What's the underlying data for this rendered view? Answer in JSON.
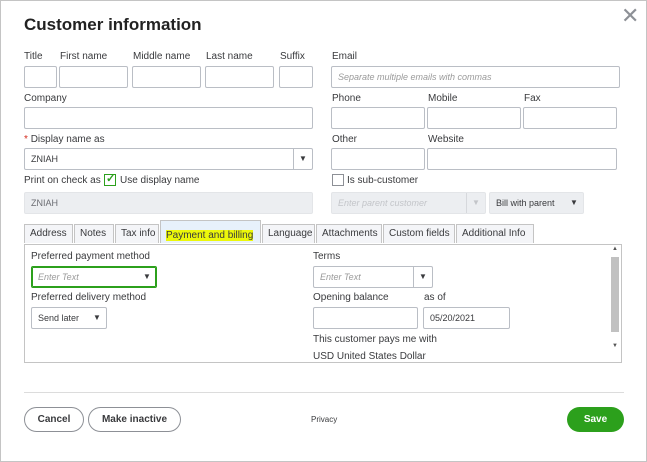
{
  "dialog": {
    "title": "Customer information",
    "close_glyph": "✕"
  },
  "name": {
    "title_label": "Title",
    "first_label": "First name",
    "middle_label": "Middle name",
    "last_label": "Last name",
    "suffix_label": "Suffix"
  },
  "email": {
    "label": "Email",
    "placeholder": "Separate multiple emails with commas"
  },
  "company": {
    "label": "Company"
  },
  "phone": {
    "label": "Phone"
  },
  "mobile": {
    "label": "Mobile"
  },
  "fax": {
    "label": "Fax"
  },
  "display_name": {
    "required_mark": "*",
    "label": "Display name as",
    "value": "ZNIAH"
  },
  "other": {
    "label": "Other"
  },
  "website": {
    "label": "Website"
  },
  "print_on_check": {
    "label": "Print on check as",
    "use_display_label": "Use display name",
    "checked": true,
    "value": "ZNIAH"
  },
  "sub_customer": {
    "label": "Is sub-customer",
    "parent_placeholder": "Enter parent customer",
    "bill_with_parent": "Bill with parent"
  },
  "tabs": [
    {
      "label": "Address"
    },
    {
      "label": "Notes"
    },
    {
      "label": "Tax info"
    },
    {
      "label": "Payment and billing"
    },
    {
      "label": "Language"
    },
    {
      "label": "Attachments"
    },
    {
      "label": "Custom fields"
    },
    {
      "label": "Additional Info"
    }
  ],
  "active_tab": "Payment and billing",
  "payment": {
    "preferred_method_label": "Preferred payment method",
    "preferred_method_placeholder": "Enter Text",
    "delivery_label": "Preferred delivery method",
    "delivery_value": "Send later",
    "terms_label": "Terms",
    "terms_placeholder": "Enter Text",
    "opening_balance_label": "Opening balance",
    "as_of_label": "as of",
    "as_of_value": "05/20/2021",
    "pays_with_label": "This customer pays me with",
    "currency_value": "USD United States Dollar"
  },
  "footer": {
    "cancel": "Cancel",
    "make_inactive": "Make inactive",
    "privacy": "Privacy",
    "save": "Save"
  },
  "colors": {
    "accent_green": "#2ca01c",
    "highlight": "#ecf70a",
    "active_tab_bg": "#e7f1fb"
  },
  "icons": {
    "caret": "▼",
    "check": "✓"
  }
}
